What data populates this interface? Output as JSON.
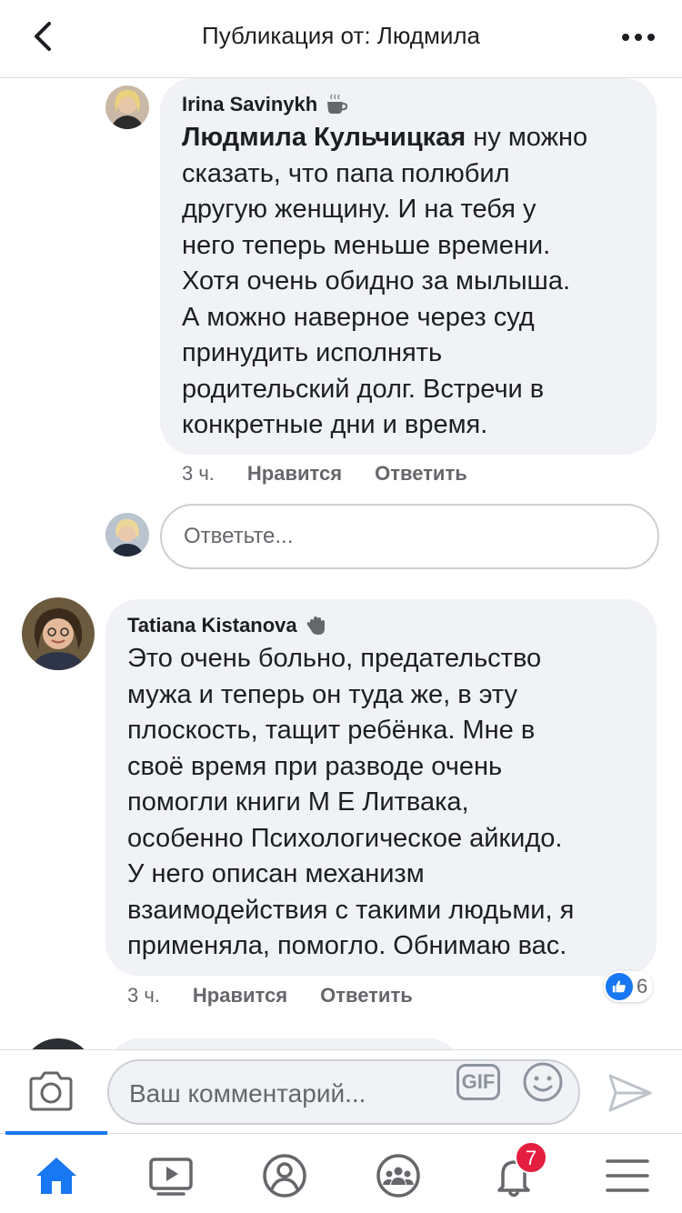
{
  "header": {
    "title": "Публикация от: Людмила"
  },
  "comments": [
    {
      "author": "Irina Savinykh",
      "badge_icon": "coffee-cup-icon",
      "mention": "Людмила Кульчицкая",
      "lines": [
        " ну можно",
        "сказать, что папа полюбил",
        "другую женщину. И на тебя у",
        "него теперь меньше времени.",
        "Хотя очень обидно за мылыша.",
        "А можно наверное через суд",
        "принудить исполнять",
        "родительский долг. Встречи в",
        "конкретные дни и время."
      ],
      "time": "3 ч.",
      "like_label": "Нравится",
      "reply_label": "Ответить"
    },
    {
      "author": "Tatiana Kistanova",
      "badge_icon": "waving-hand-icon",
      "lines": [
        "Это очень больно, предательство",
        "мужа и теперь он туда же, в эту",
        "плоскость, тащит ребёнка. Мне в",
        "своё время при разводе очень",
        "помогли книги М Е Литвака,",
        "особенно Психологическое айкидо.",
        "У него описан механизм",
        "взаимодействия с такими людьми, я",
        "применяла, помогло. Обнимаю вас."
      ],
      "time": "3 ч.",
      "like_label": "Нравится",
      "reply_label": "Ответить",
      "reactions": {
        "type": "like",
        "count": "6"
      }
    }
  ],
  "reply": {
    "placeholder": "Ответьте..."
  },
  "composer": {
    "placeholder": "Ваш комментарий...",
    "gif_label": "GIF"
  },
  "tabbar": {
    "items": [
      "home-icon",
      "video-icon",
      "profile-icon",
      "groups-icon",
      "notifications-icon",
      "menu-icon"
    ],
    "notification_count": "7",
    "active_color": "#1877f2"
  }
}
